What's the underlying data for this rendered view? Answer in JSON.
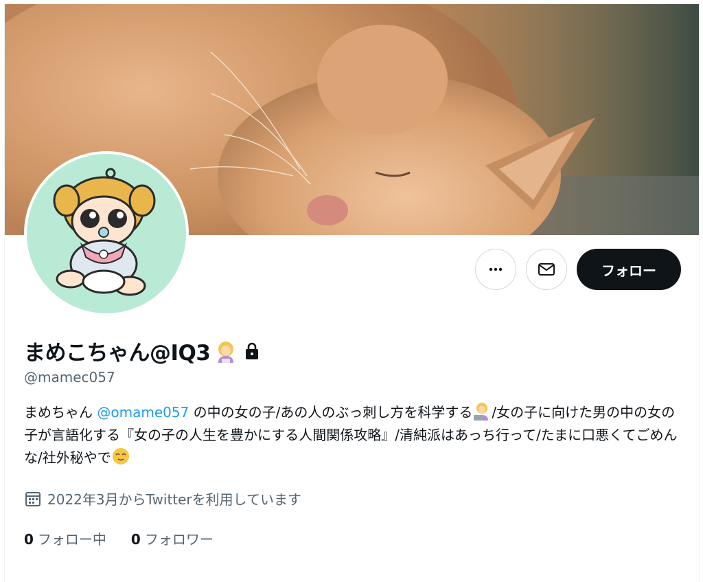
{
  "profile": {
    "display_name": "まめこちゃん@IQ3",
    "handle": "@mamec057",
    "bio_before_mention": "まめちゃん ",
    "bio_mention": "@omame057",
    "bio_part2": " の中の女の子/あの人のぶっ刺し方を科学する",
    "bio_part3": "/女の子に向けた男の中の女の子が言語化する『女の子の人生を豊かにする人間関係攻略』/清純派はあっち行って/たまに口悪くてごめんな/社外秘やで",
    "joined": "2022年3月からTwitterを利用しています"
  },
  "actions": {
    "follow_label": "フォロー"
  },
  "stats": {
    "following_count": "0",
    "following_label": "フォロー中",
    "followers_count": "0",
    "followers_label": "フォロワー"
  },
  "icons": {
    "more": "more-icon",
    "message": "envelope-icon",
    "calendar": "calendar-icon",
    "lock": "lock-icon",
    "name_emoji": "woman-emoji-icon",
    "bio_emoji_1": "woman-technologist-emoji-icon",
    "bio_emoji_2": "relieved-face-emoji-icon"
  },
  "colors": {
    "accent": "#1d9bf0",
    "follow_bg": "#0f1419",
    "secondary_text": "#536471",
    "avatar_bg": "#b8ead6"
  }
}
